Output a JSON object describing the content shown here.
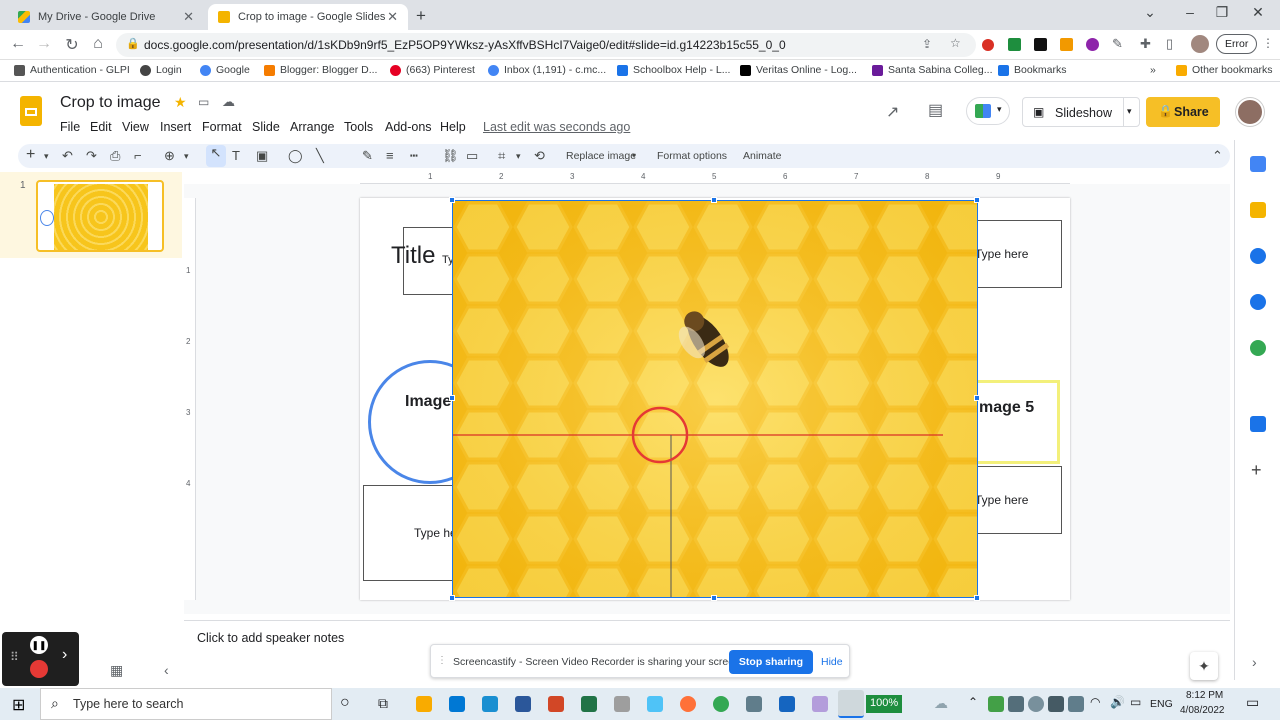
{
  "browser": {
    "tabs": [
      {
        "title": "My Drive - Google Drive"
      },
      {
        "title": "Crop to image - Google Slides"
      }
    ],
    "url": "docs.google.com/presentation/d/1sKDb9n9rf5_EzP5OP9YWksz-yAsXffvBSHcI7Vaige0/edit#slide=id.g14223b15c55_0_0",
    "error_label": "Error",
    "bookmarks": [
      "Authentication - GLPI",
      "Login",
      "Google",
      "Blogger: Blogger D...",
      "(663) Pinterest",
      "Inbox (1,191) - c.mc...",
      "Schoolbox Help - L...",
      "Veritas Online - Log...",
      "Santa Sabina Colleg...",
      "Bookmarks"
    ],
    "other_bookmarks": "Other bookmarks"
  },
  "doc": {
    "title": "Crop to image",
    "last_edit": "Last edit was seconds ago",
    "menus": [
      "File",
      "Edit",
      "View",
      "Insert",
      "Format",
      "Slide",
      "Arrange",
      "Tools",
      "Add-ons",
      "Help"
    ],
    "slideshow_label": "Slideshow",
    "share_label": "Share"
  },
  "toolbar": {
    "replace_image": "Replace image",
    "format_options": "Format options",
    "animate": "Animate"
  },
  "ruler": {
    "h": [
      "1",
      "2",
      "3",
      "4",
      "5",
      "6",
      "7",
      "8",
      "9"
    ],
    "v": [
      "1",
      "2",
      "3",
      "4"
    ]
  },
  "filmstrip": {
    "slide_number": "1"
  },
  "slide": {
    "title_text": "Title",
    "title_sub": "Ty",
    "type_here_right1": "Type here",
    "type_here_right2": "Type here",
    "type_here_left": "Type he",
    "image_circle_label": "Image",
    "image5_label": "mage 5"
  },
  "notes": {
    "placeholder": "Click to add speaker notes"
  },
  "sharing_bar": {
    "message": "Screencastify - Screen Video Recorder is sharing your screen.",
    "stop_label": "Stop sharing",
    "hide_label": "Hide"
  },
  "taskbar": {
    "search_placeholder": "Type here to search",
    "battery": "100%",
    "lang": "ENG",
    "time": "8:12 PM",
    "date": "4/08/2022"
  },
  "colors": {
    "accent": "#1a73e8",
    "share": "#f6bf26",
    "honey": "#f7c51c"
  }
}
